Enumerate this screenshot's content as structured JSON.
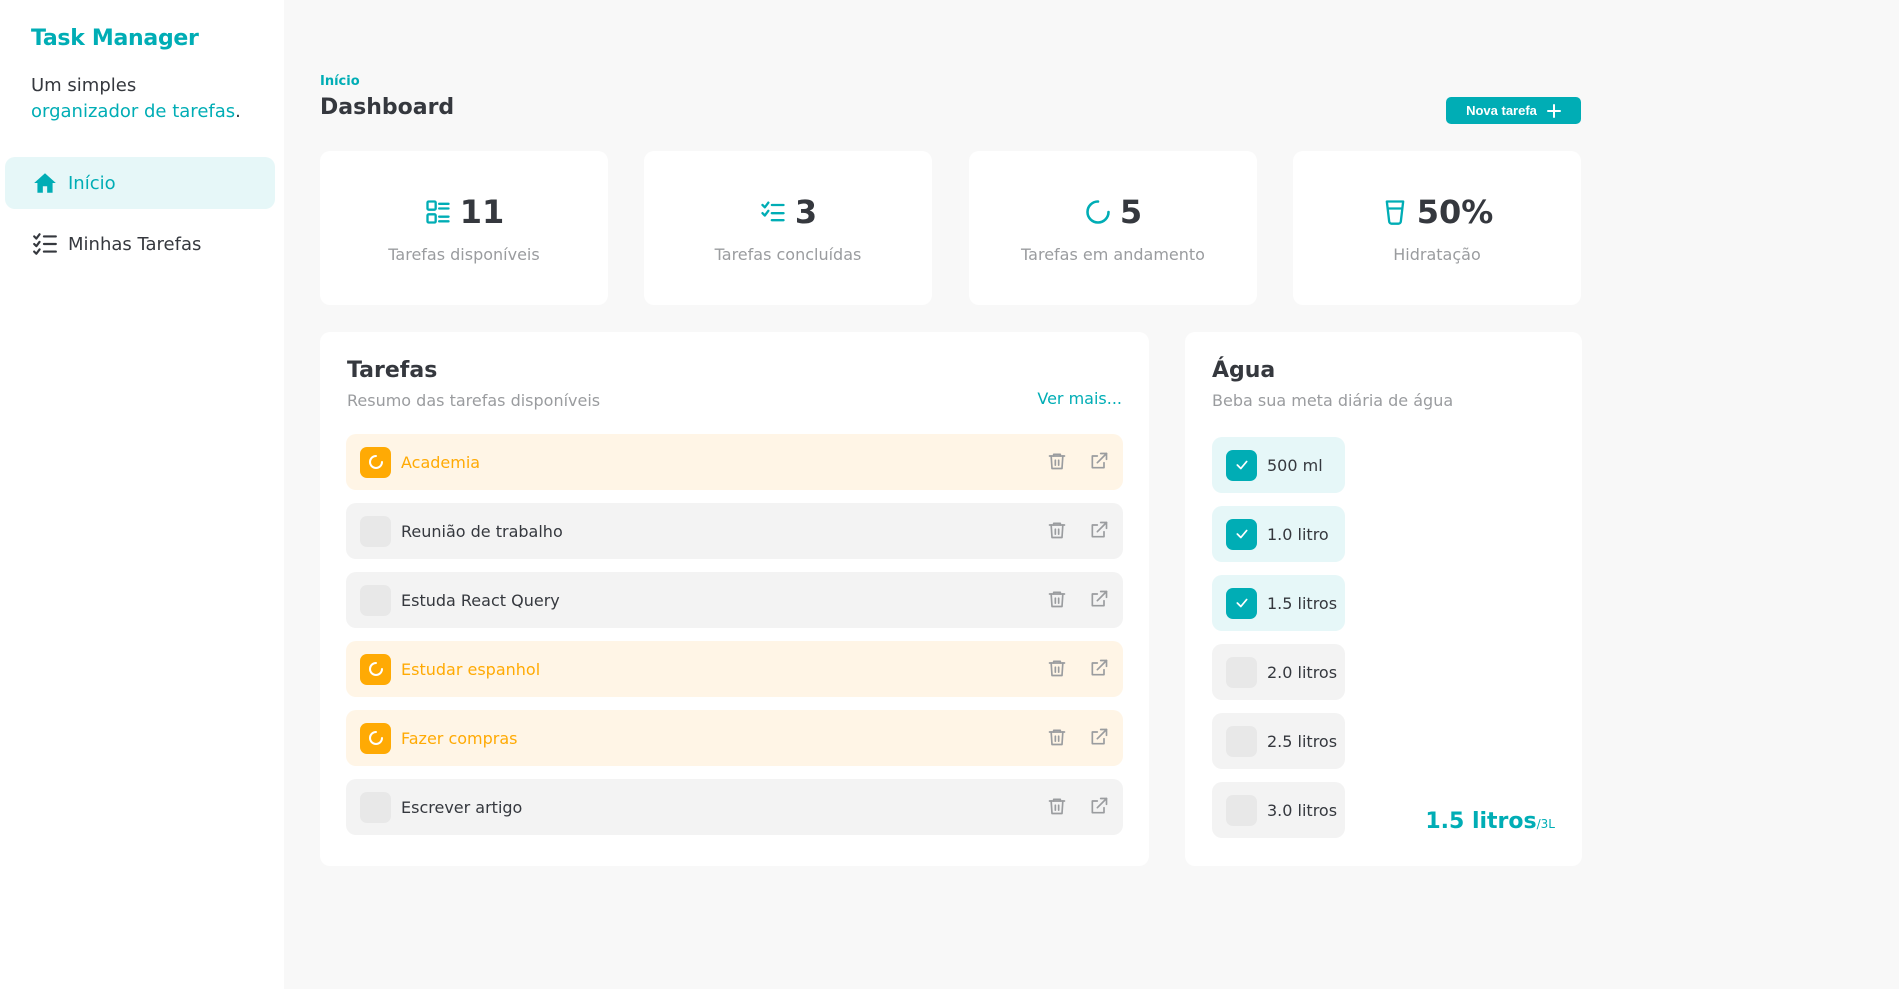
{
  "sidebar": {
    "brand": "Task Manager",
    "tagline_plain": "Um simples",
    "tagline_accent": "organizador de tarefas",
    "tagline_end": ".",
    "items": [
      {
        "label": "Início",
        "icon": "home-icon",
        "active": true
      },
      {
        "label": "Minhas Tarefas",
        "icon": "list-check-icon",
        "active": false
      }
    ]
  },
  "header": {
    "breadcrumb": "Início",
    "title": "Dashboard",
    "new_task_label": "Nova tarefa"
  },
  "stats": [
    {
      "value": "11",
      "label": "Tarefas disponíveis",
      "icon": "task-list-icon"
    },
    {
      "value": "3",
      "label": "Tarefas concluídas",
      "icon": "checklist-icon"
    },
    {
      "value": "5",
      "label": "Tarefas em andamento",
      "icon": "loader-icon"
    },
    {
      "value": "50%",
      "label": "Hidratação",
      "icon": "glass-water-icon"
    }
  ],
  "tasks": {
    "title": "Tarefas",
    "subtitle": "Resumo das tarefas disponíveis",
    "see_more": "Ver mais...",
    "items": [
      {
        "name": "Academia",
        "status": "in_progress"
      },
      {
        "name": "Reunião de trabalho",
        "status": "not_started"
      },
      {
        "name": "Estuda React Query",
        "status": "not_started"
      },
      {
        "name": "Estudar espanhol",
        "status": "in_progress"
      },
      {
        "name": "Fazer compras",
        "status": "in_progress"
      },
      {
        "name": "Escrever artigo",
        "status": "not_started"
      }
    ]
  },
  "water": {
    "title": "Água",
    "subtitle": "Beba sua meta diária de água",
    "items": [
      {
        "label": "500 ml",
        "done": true
      },
      {
        "label": "1.0 litro",
        "done": true
      },
      {
        "label": "1.5 litros",
        "done": true
      },
      {
        "label": "2.0 litros",
        "done": false
      },
      {
        "label": "2.5 litros",
        "done": false
      },
      {
        "label": "3.0 litros",
        "done": false
      }
    ],
    "total": "1.5 litros",
    "goal": "/3L"
  },
  "colors": {
    "brand": "#00adb5",
    "in_progress": "#ffaa04",
    "text": "#35383e",
    "muted": "#9a9c9f"
  }
}
